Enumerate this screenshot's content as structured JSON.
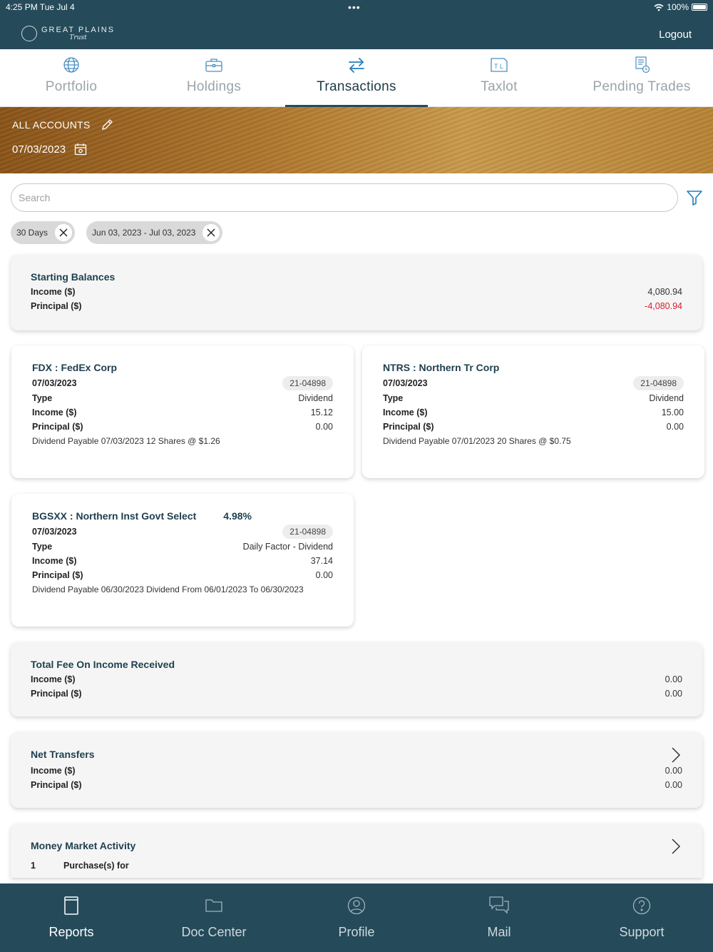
{
  "status": {
    "time": "4:25 PM  Tue Jul 4",
    "battery": "100%"
  },
  "header": {
    "logo_title": "GREAT PLAINS",
    "logo_subtitle": "Trust",
    "logout": "Logout"
  },
  "tabs": [
    {
      "label": "Portfolio",
      "icon": "globe-icon"
    },
    {
      "label": "Holdings",
      "icon": "briefcase-icon"
    },
    {
      "label": "Transactions",
      "icon": "arrows-swap-icon",
      "active": true
    },
    {
      "label": "Taxlot",
      "icon": "taxlot-icon"
    },
    {
      "label": "Pending Trades",
      "icon": "document-clock-icon"
    }
  ],
  "banner": {
    "account": "ALL ACCOUNTS",
    "date": "07/03/2023"
  },
  "search": {
    "placeholder": "Search"
  },
  "chips": [
    {
      "label": "30 Days"
    },
    {
      "label": "Jun 03, 2023 - Jul 03, 2023"
    }
  ],
  "starting_balances": {
    "title": "Starting Balances",
    "income_label": "Income ($)",
    "income": "4,080.94",
    "principal_label": "Principal ($)",
    "principal": "-4,080.94"
  },
  "transactions": [
    {
      "title": "FDX : FedEx Corp",
      "yield": "",
      "date": "07/03/2023",
      "account": "21-04898",
      "type_label": "Type",
      "type": "Dividend",
      "income_label": "Income ($)",
      "income": "15.12",
      "principal_label": "Principal ($)",
      "principal": "0.00",
      "description": "Dividend Payable 07/03/2023 12 Shares @ $1.26"
    },
    {
      "title": "NTRS : Northern Tr Corp",
      "yield": "",
      "date": "07/03/2023",
      "account": "21-04898",
      "type_label": "Type",
      "type": "Dividend",
      "income_label": "Income ($)",
      "income": "15.00",
      "principal_label": "Principal ($)",
      "principal": "0.00",
      "description": "Dividend Payable 07/01/2023 20 Shares @ $0.75"
    },
    {
      "title": "BGSXX : Northern Inst Govt Select",
      "yield": "4.98%",
      "date": "07/03/2023",
      "account": "21-04898",
      "type_label": "Type",
      "type": "Daily Factor - Dividend",
      "income_label": "Income ($)",
      "income": "37.14",
      "principal_label": "Principal ($)",
      "principal": "0.00",
      "description": "Dividend Payable 06/30/2023 Dividend From 06/01/2023 To 06/30/2023"
    }
  ],
  "total_fee": {
    "title": "Total Fee On Income Received",
    "income_label": "Income ($)",
    "income": "0.00",
    "principal_label": "Principal ($)",
    "principal": "0.00"
  },
  "net_transfers": {
    "title": "Net Transfers",
    "income_label": "Income ($)",
    "income": "0.00",
    "principal_label": "Principal ($)",
    "principal": "0.00"
  },
  "money_market": {
    "title": "Money Market Activity",
    "count": "1",
    "item": "Purchase(s) for"
  },
  "bottom_nav": [
    {
      "label": "Reports",
      "icon": "reports-icon",
      "active": true
    },
    {
      "label": "Doc Center",
      "icon": "folder-icon"
    },
    {
      "label": "Profile",
      "icon": "profile-icon"
    },
    {
      "label": "Mail",
      "icon": "chat-bubbles-icon"
    },
    {
      "label": "Support",
      "icon": "question-icon"
    }
  ],
  "colors": {
    "brand": "#254a5a",
    "accent": "#1e3f4e",
    "negative": "#d6202a",
    "filter_icon": "#1f7fbf"
  }
}
